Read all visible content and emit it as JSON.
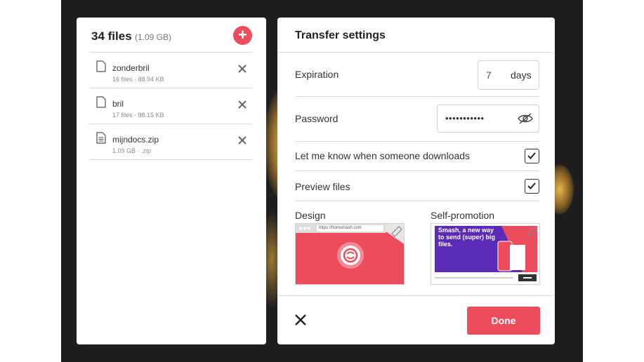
{
  "files_panel": {
    "title": "34 files",
    "total_size": "(1.09 GB)",
    "add_label": "+",
    "files": [
      {
        "name": "zonderbril",
        "count": "16 files",
        "size": "88.94 KB",
        "icon": "folder-icon"
      },
      {
        "name": "bril",
        "count": "17 files",
        "size": "98.15 KB",
        "icon": "folder-icon"
      },
      {
        "name": "mijndocs.zip",
        "count": "1.09 GB",
        "size": ".zip",
        "icon": "document-icon"
      }
    ]
  },
  "settings": {
    "title": "Transfer settings",
    "expiration": {
      "label": "Expiration",
      "value": "7",
      "unit": "days"
    },
    "password": {
      "label": "Password",
      "value": "•••••••••••"
    },
    "notify": {
      "label": "Let me know when someone downloads",
      "checked": true
    },
    "preview": {
      "label": "Preview files",
      "checked": true
    },
    "design": {
      "label": "Design",
      "url": "https://fromsmash.com"
    },
    "promo": {
      "label": "Self-promotion",
      "text": "Smash, a new way to send (super) big files."
    },
    "done_label": "Done"
  },
  "colors": {
    "accent": "#ec4c5c",
    "promo_purple": "#5b2bb8"
  }
}
